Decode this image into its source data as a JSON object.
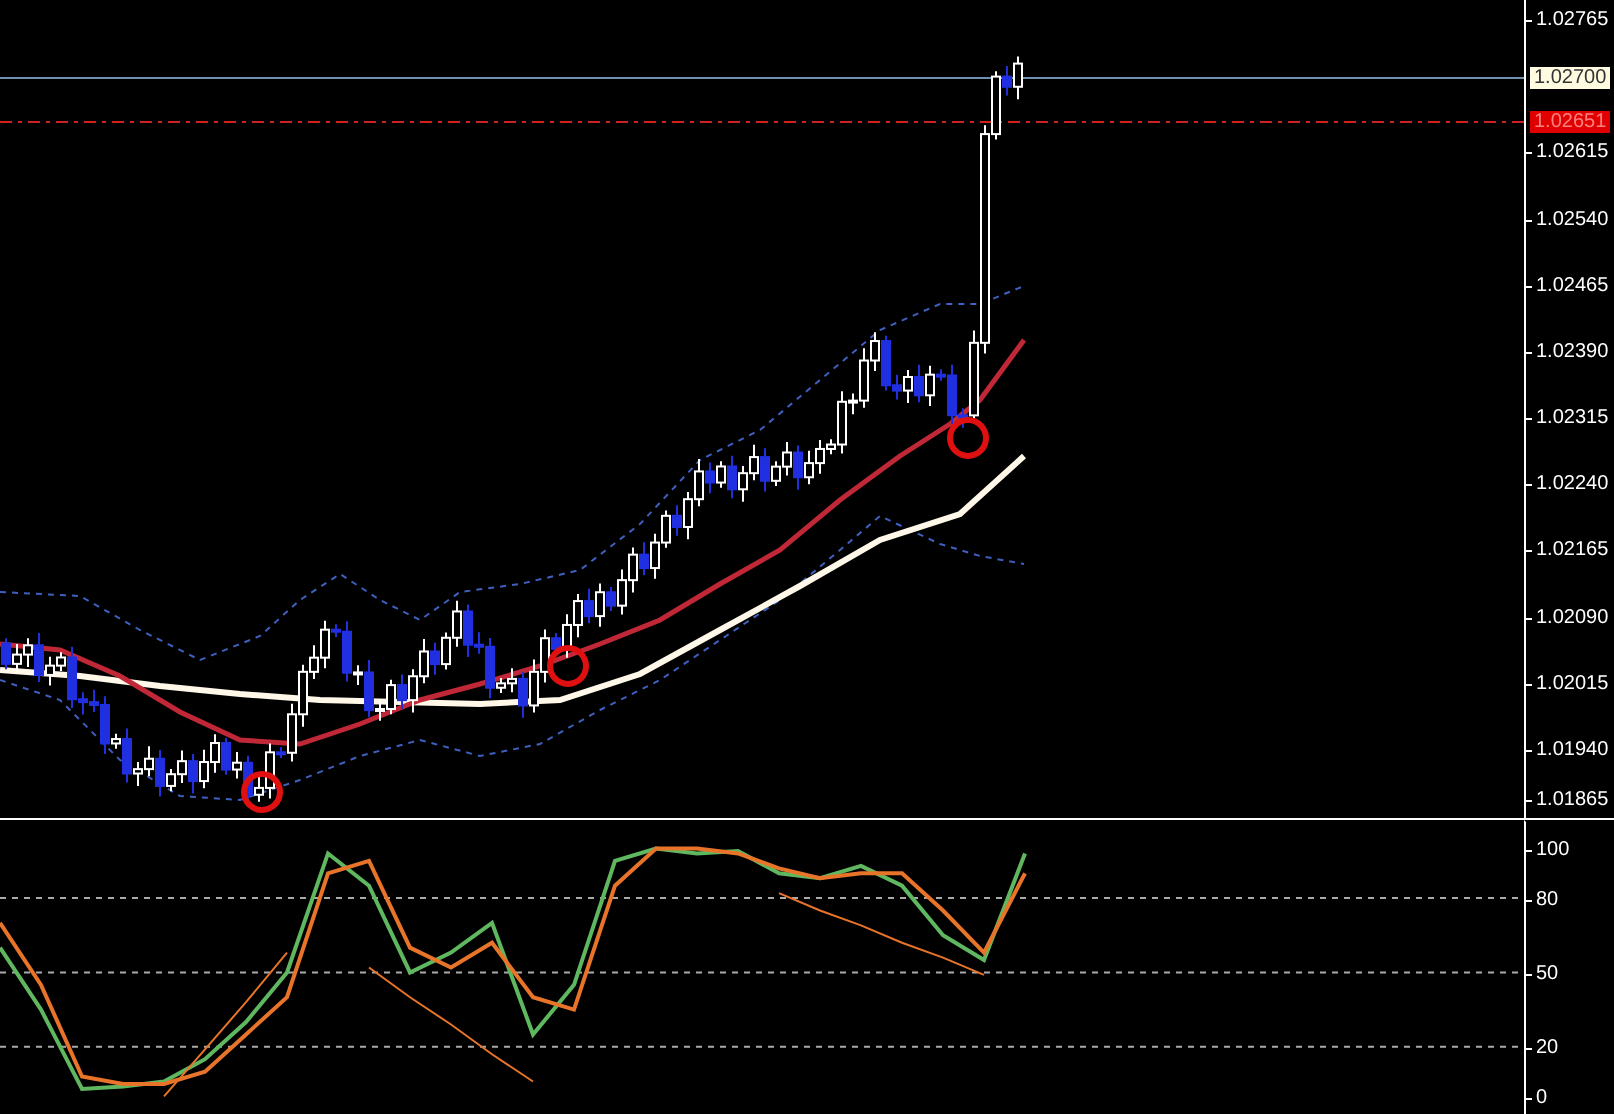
{
  "price_axis": {
    "labels": [
      "1.02765",
      "1.02615",
      "1.02540",
      "1.02465",
      "1.02390",
      "1.02315",
      "1.02240",
      "1.02165",
      "1.02090",
      "1.02015",
      "1.01940",
      "1.01865"
    ],
    "markers": [
      {
        "kind": "bid",
        "text": "1.02700"
      },
      {
        "kind": "alert",
        "text": "1.02651"
      }
    ]
  },
  "oscillator": {
    "chart_data": {
      "type": "line",
      "grid": true,
      "ylim": [
        -7.1,
        111.5
      ],
      "yticks": [
        {
          "value": 0,
          "label": "0"
        },
        {
          "value": 20,
          "label": "20"
        },
        {
          "value": 50,
          "label": "50"
        },
        {
          "value": 80,
          "label": "80"
        },
        {
          "value": 100,
          "label": "100"
        }
      ],
      "series": [
        {
          "color": "#5fb85f",
          "values": [
            60,
            35,
            3,
            4,
            6,
            15,
            30,
            50,
            98,
            85,
            50,
            58,
            70,
            25,
            45,
            95,
            100,
            98,
            99,
            90,
            88,
            93,
            85,
            65,
            55,
            98
          ]
        },
        {
          "color": "#e8742a",
          "values": [
            70,
            45,
            8,
            5,
            5,
            10,
            25,
            40,
            90,
            95,
            60,
            52,
            62,
            40,
            35,
            85,
            100,
            100,
            98,
            92,
            88,
            90,
            90,
            75,
            58,
            90
          ]
        },
        {
          "color": "#e8742a",
          "values": [
            null,
            null,
            null,
            null,
            0,
            19,
            38,
            58,
            null,
            52,
            40,
            29,
            17,
            6,
            null,
            null,
            null,
            null,
            null,
            82,
            75,
            69,
            62,
            56,
            49,
            null
          ]
        }
      ]
    }
  }
}
